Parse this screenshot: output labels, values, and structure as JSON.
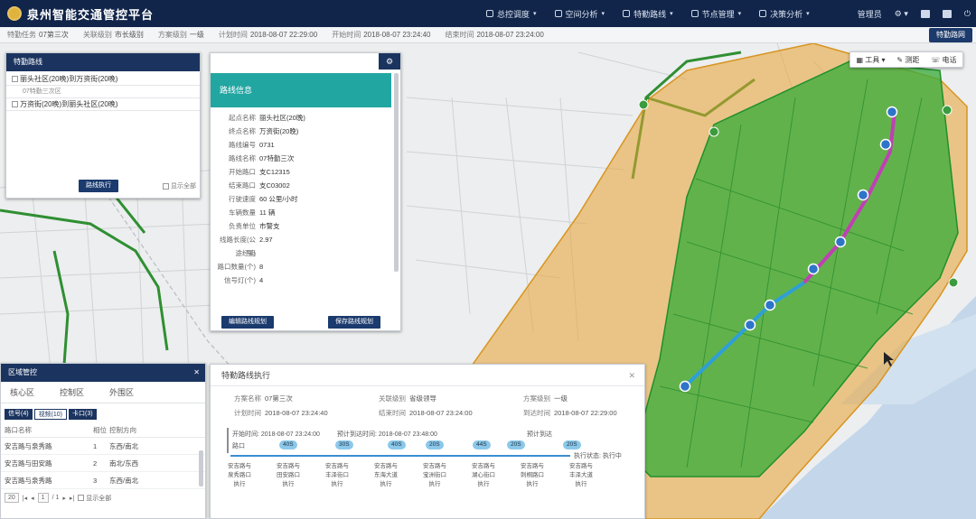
{
  "app": {
    "title": "泉州智能交通管控平台"
  },
  "menu": [
    {
      "label": "总控调度"
    },
    {
      "label": "空间分析"
    },
    {
      "label": "特勤路线"
    },
    {
      "label": "节点管理"
    },
    {
      "label": "决策分析"
    }
  ],
  "rightnav": {
    "user": "管理员"
  },
  "infobar": {
    "task_label": "特勤任务",
    "task_value": "07第三次",
    "level_label": "关联级别",
    "level_value": "市长级别",
    "mode_label": "方案级别",
    "mode_value": "一级",
    "plan_label": "计划时间",
    "plan_value": "2018-08-07 22:29:00",
    "start_label": "开始时间",
    "start_value": "2018-08-07 23:24:40",
    "end_label": "结束时间",
    "end_value": "2018-08-07 23:24:00",
    "button": "特勤路网"
  },
  "map_toolbar": {
    "items": [
      "工具",
      "测距",
      "电话"
    ]
  },
  "route_panel": {
    "header": "特勤路线",
    "rows": [
      "丽头社区(20晚)到万资街(20晚)",
      "07特勤三次区",
      "万资街(20晚)到丽头社区(20晚)"
    ],
    "button": "路线执行",
    "checkbox": "显示全部"
  },
  "route_info": {
    "header": "路线信息",
    "fields": [
      {
        "k": "起点名称",
        "v": "丽头社区(20晚)"
      },
      {
        "k": "终点名称",
        "v": "万资街(20晚)"
      },
      {
        "k": "路线编号",
        "v": "0731"
      },
      {
        "k": "路线名称",
        "v": "07特勤三次"
      },
      {
        "k": "开始路口",
        "v": "支C12315"
      },
      {
        "k": "结束路口",
        "v": "支C03002"
      },
      {
        "k": "行驶速度",
        "v": "60 公里/小时"
      },
      {
        "k": "车辆数量",
        "v": "11 辆"
      },
      {
        "k": "负责单位",
        "v": "市警支"
      },
      {
        "k": "线路长度(公里)",
        "v": "2.97"
      },
      {
        "k": "途经点",
        "v": ""
      },
      {
        "k": "路口数量(个)",
        "v": "8"
      },
      {
        "k": "信号灯(个)",
        "v": "4"
      }
    ],
    "button_left": "编辑路线规划",
    "button_right": "保存路线规划"
  },
  "region_panel": {
    "header": "区域管控",
    "tabs": [
      "核心区",
      "控制区",
      "外围区"
    ],
    "subtabs": [
      "信号(4)",
      "视频(10)",
      "卡口(3)"
    ],
    "columns": [
      "路口名称",
      "相位",
      "控制方向"
    ],
    "rows": [
      {
        "name": "安吉路与泉秀路",
        "phase": "1",
        "dir": "东西/南北"
      },
      {
        "name": "安吉路与田安路",
        "phase": "2",
        "dir": "南北/东西"
      },
      {
        "name": "安吉路与泉秀路",
        "phase": "3",
        "dir": "东西/南北"
      }
    ],
    "pager": {
      "size": "20",
      "page": "1",
      "total": "/ 1",
      "check": "显示全部"
    }
  },
  "exec_panel": {
    "header": "特勤路线执行",
    "row1": [
      {
        "k": "方案名称",
        "v": "07第三次"
      },
      {
        "k": "关联级别",
        "v": "省级领导"
      },
      {
        "k": "方案级别",
        "v": "一级"
      }
    ],
    "row2": [
      {
        "k": "计划时间",
        "v": "2018-08-07 23:24:40"
      },
      {
        "k": "结束时间",
        "v": "2018-08-07 23:24:00"
      },
      {
        "k": "到达时间",
        "v": "2018-08-07 22:29:00"
      }
    ],
    "start_note": "开始时间: 2018-08-07 23:24:00",
    "start_note2": "预计到达时间: 2018-08-07 23:48:00",
    "end_note": "预计到达",
    "legend_left": "路口",
    "pills": [
      "40S",
      "30S",
      "40S",
      "20S",
      "44S",
      "20S",
      "20S"
    ],
    "stages": [
      {
        "a": "安吉路与",
        "b": "泉秀路口",
        "c": "执行"
      },
      {
        "a": "安吉路与",
        "b": "田安路口",
        "c": "执行"
      },
      {
        "a": "安吉路与",
        "b": "丰泽街口",
        "c": "执行"
      },
      {
        "a": "安吉路与",
        "b": "东海大道",
        "c": "执行"
      },
      {
        "a": "安吉路与",
        "b": "宝洲街口",
        "c": "执行"
      },
      {
        "a": "安吉路与",
        "b": "湖心街口",
        "c": "执行"
      },
      {
        "a": "安吉路与",
        "b": "刺桐路口",
        "c": "执行"
      },
      {
        "a": "安吉路与",
        "b": "丰泽大道",
        "c": "执行"
      }
    ],
    "right_note": "执行状态: 执行中"
  },
  "colors": {
    "nav": "#11254a",
    "teal": "#22a6a2",
    "green": "#3cad3c",
    "orange": "#e7a330",
    "route": "#c13fb5",
    "route2": "#2e9fd7"
  }
}
